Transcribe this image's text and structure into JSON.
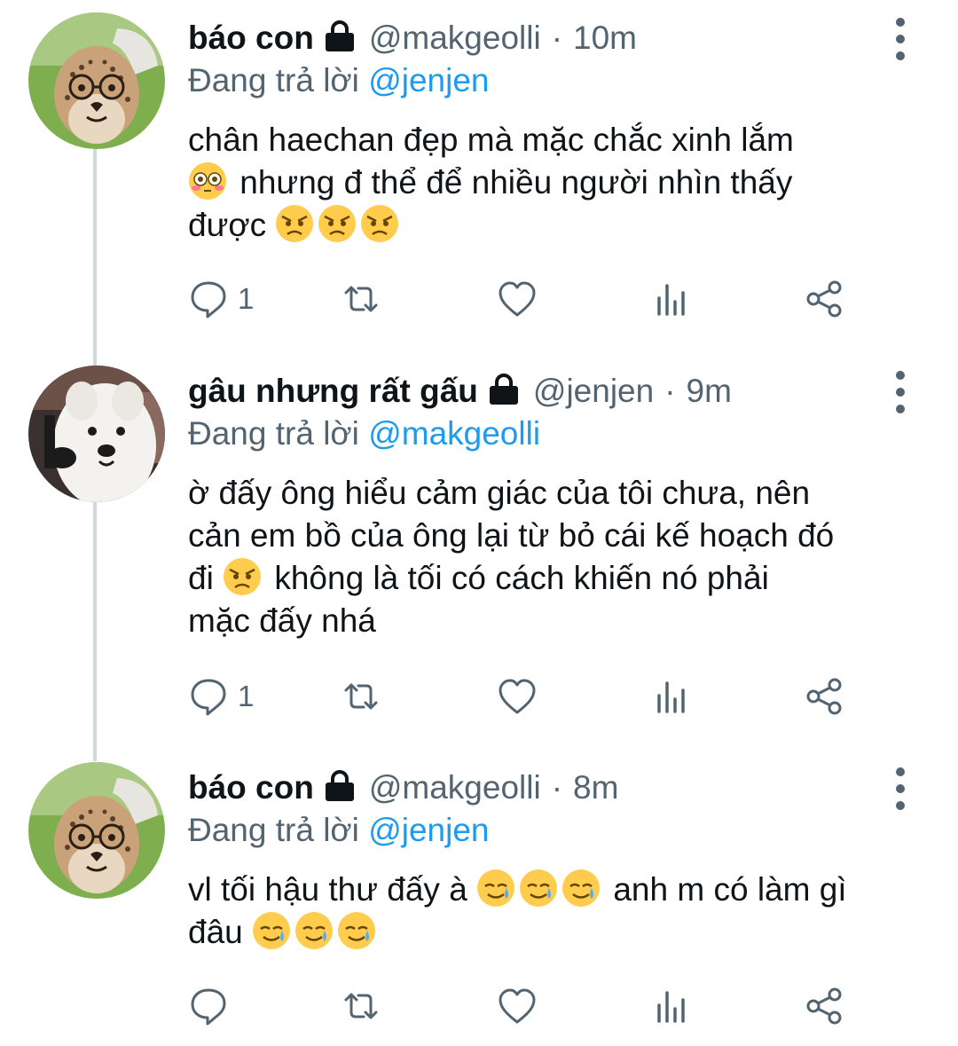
{
  "colors": {
    "text_primary": "#0f1419",
    "text_secondary": "#536471",
    "mention": "#1d9bf0",
    "thread_line": "#cfd9de"
  },
  "replying_prefix": "Đang trả lời",
  "tweets": [
    {
      "display_name": "báo con",
      "handle": "@makgeolli",
      "separator": "·",
      "time": "10m",
      "reply_to": "@jenjen",
      "avatar": "cheetah-cub-with-glasses",
      "protected_icon": "lock-icon",
      "body_lines": [
        {
          "text": "chân haechan đẹp mà mặc chắc xinh lắm",
          "emoji_before": [],
          "emoji_after": []
        },
        {
          "text": " nhưng đ thể để nhiều người nhìn thấy",
          "emoji_before": [
            "flushed-face"
          ],
          "emoji_after": []
        },
        {
          "text": "được ",
          "emoji_before": [],
          "emoji_after": [
            "angry-face",
            "angry-face",
            "angry-face"
          ]
        }
      ],
      "reply_count": "1",
      "retweet_count": "",
      "like_count": ""
    },
    {
      "display_name": "gâu nhưng rất gấu",
      "handle": "@jenjen",
      "separator": "·",
      "time": "9m",
      "reply_to": "@makgeolli",
      "avatar": "samoyed-dog-with-microphone",
      "protected_icon": "lock-icon",
      "body_lines": [
        {
          "text": "ờ đấy ông hiểu cảm giác của tôi chưa, nên",
          "emoji_before": [],
          "emoji_after": []
        },
        {
          "text": "cản em bồ của ông lại từ bỏ cái kế hoạch đó",
          "emoji_before": [],
          "emoji_after": []
        },
        {
          "text": "đi ",
          "emoji_before": [],
          "emoji_after": [
            "angry-face"
          ],
          "text_after": " không là tối có cách khiến nó phải"
        },
        {
          "text": "mặc đấy nhá",
          "emoji_before": [],
          "emoji_after": []
        }
      ],
      "reply_count": "1",
      "retweet_count": "",
      "like_count": ""
    },
    {
      "display_name": "báo con",
      "handle": "@makgeolli",
      "separator": "·",
      "time": "8m",
      "reply_to": "@jenjen",
      "avatar": "cheetah-cub-with-glasses",
      "protected_icon": "lock-icon",
      "body_lines": [
        {
          "text": "vl tối hậu thư đấy à ",
          "emoji_before": [],
          "emoji_after": [
            "smiling-face-with-tear",
            "smiling-face-with-tear",
            "smiling-face-with-tear"
          ],
          "text_after": " anh m có làm gì"
        },
        {
          "text": "đâu ",
          "emoji_before": [],
          "emoji_after": [
            "smiling-face-with-tear",
            "smiling-face-with-tear",
            "smiling-face-with-tear"
          ]
        }
      ],
      "reply_count": "",
      "retweet_count": "",
      "like_count": ""
    }
  ],
  "action_icons": [
    "reply-icon",
    "retweet-icon",
    "like-icon",
    "analytics-icon",
    "share-icon"
  ]
}
